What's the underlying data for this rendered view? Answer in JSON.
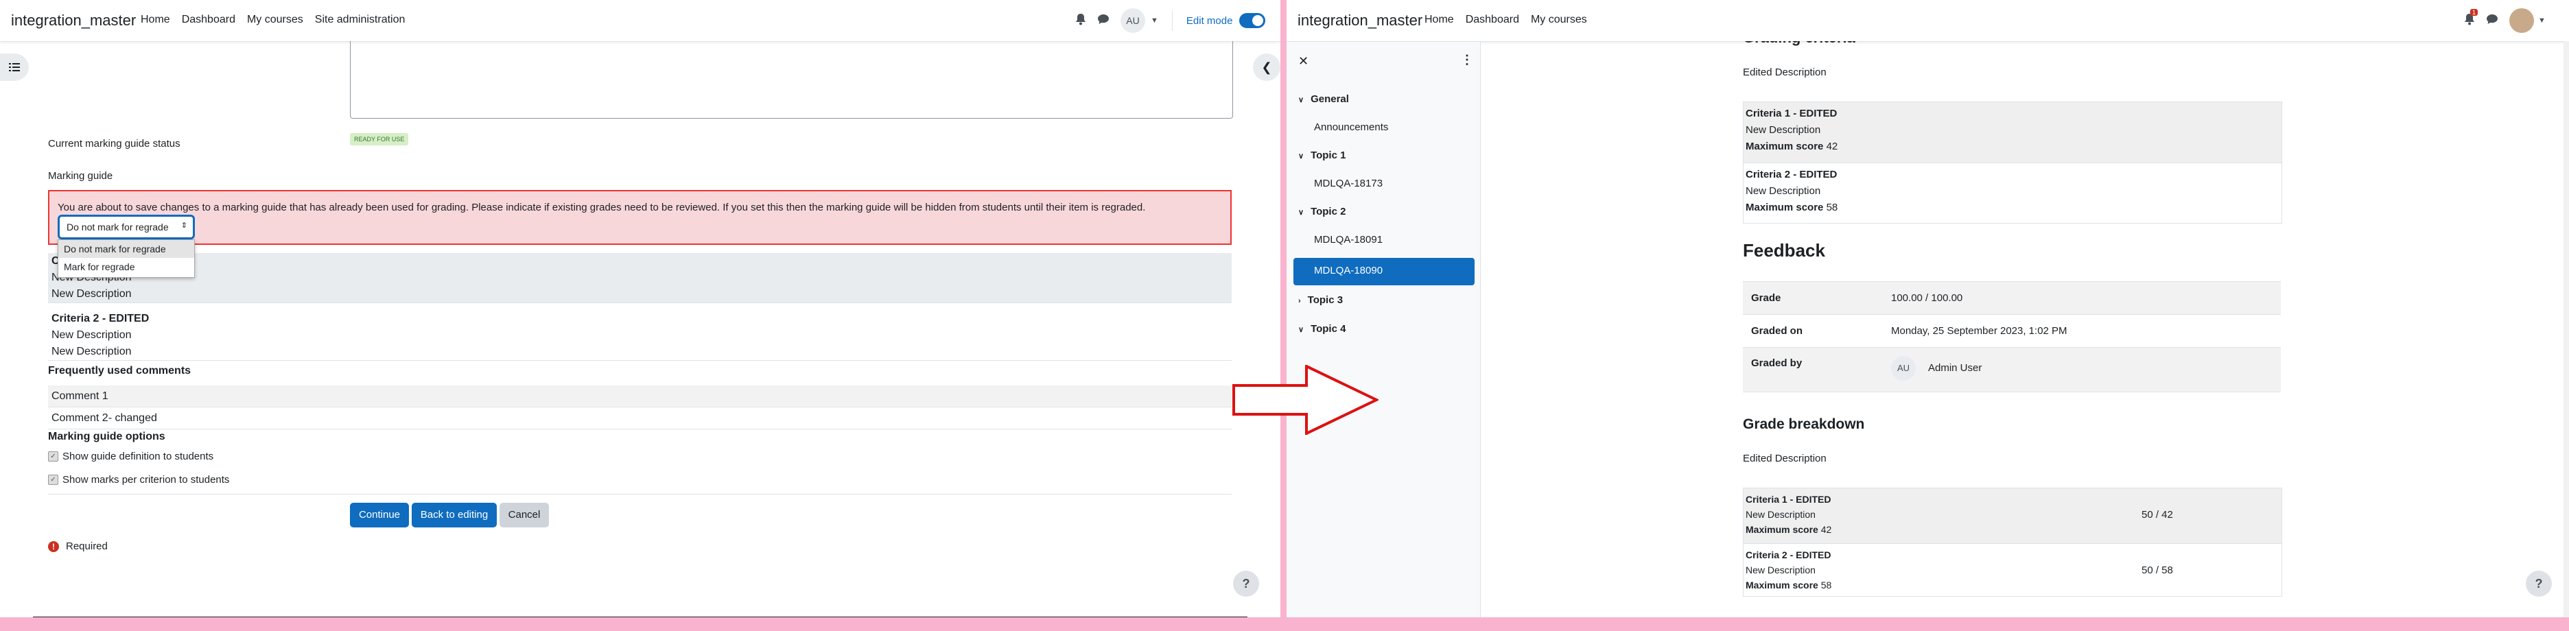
{
  "left": {
    "nav": {
      "brand": "integration_master",
      "links": [
        "Home",
        "Dashboard",
        "My courses",
        "Site administration"
      ],
      "avatar": "AU",
      "edit_mode_label": "Edit mode"
    },
    "status_label": "Current marking guide status",
    "status_badge": "READY FOR USE",
    "guide_label": "Marking guide",
    "alert_message": "You are about to save changes to a marking guide that has already been used for grading. Please indicate if existing grades need to be reviewed. If you set this then the marking guide will be hidden from students until their item is regraded.",
    "regrade_select_value": "Do not mark for regrade",
    "regrade_options": [
      "Do not mark for regrade",
      "Mark for regrade"
    ],
    "criteria": [
      {
        "title": "C",
        "lines": [
          "New Description",
          "New Description"
        ]
      },
      {
        "title": "Criteria 2 - EDITED",
        "lines": [
          "New Description",
          "New Description"
        ]
      }
    ],
    "comments_heading": "Frequently used comments",
    "comments": [
      "Comment 1",
      "Comment 2- changed"
    ],
    "options_heading": "Marking guide options",
    "options": [
      "Show guide definition to students",
      "Show marks per criterion to students"
    ],
    "buttons": {
      "continue": "Continue",
      "back": "Back to editing",
      "cancel": "Cancel"
    },
    "required": "Required",
    "help": "?"
  },
  "right": {
    "nav": {
      "brand": "integration_master",
      "links": [
        "Home",
        "Dashboard",
        "My courses"
      ],
      "notification_count": "1"
    },
    "drawer": {
      "sections": [
        {
          "title": "General",
          "items": [
            "Announcements"
          ]
        },
        {
          "title": "Topic 1",
          "items": [
            "MDLQA-18173"
          ]
        },
        {
          "title": "Topic 2",
          "items": [
            "MDLQA-18091",
            "MDLQA-18090"
          ]
        },
        {
          "title": "Topic 3",
          "items": []
        },
        {
          "title": "Topic 4",
          "items": []
        }
      ],
      "active_item": "MDLQA-18090"
    },
    "partial_heading": "Grading criteria",
    "edited_description": "Edited Description",
    "criteria_top": [
      {
        "title": "Criteria 1 - EDITED",
        "desc": "New Description",
        "max_label": "Maximum score",
        "max": "42"
      },
      {
        "title": "Criteria 2 - EDITED",
        "desc": "New Description",
        "max_label": "Maximum score",
        "max": "58"
      }
    ],
    "feedback_heading": "Feedback",
    "feedback": {
      "grade_label": "Grade",
      "grade": "100.00 / 100.00",
      "graded_on_label": "Graded on",
      "graded_on": "Monday, 25 September 2023, 1:02 PM",
      "graded_by_label": "Graded by",
      "grader_initials": "AU",
      "grader": "Admin User"
    },
    "breakdown_heading": "Grade breakdown",
    "breakdown_description": "Edited Description",
    "breakdown": [
      {
        "title": "Criteria 1 - EDITED",
        "desc": "New Description",
        "max_label": "Maximum score",
        "max": "42",
        "score": "50 / 42"
      },
      {
        "title": "Criteria 2 - EDITED",
        "desc": "New Description",
        "max_label": "Maximum score",
        "max": "58",
        "score": "50 / 58"
      }
    ],
    "help": "?"
  },
  "colors": {
    "primary": "#0f6cbf",
    "alert_bg": "#f8d7da",
    "alert_border": "#e33",
    "arrow": "#dd1111",
    "divider": "#f9b3cf"
  }
}
